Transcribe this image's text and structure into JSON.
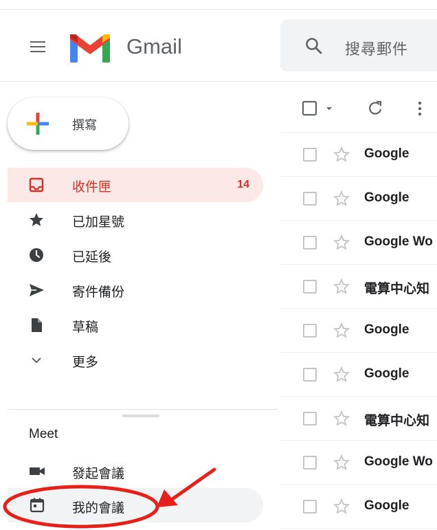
{
  "header": {
    "brand": "Gmail",
    "search_placeholder": "搜尋郵件"
  },
  "compose": {
    "label": "撰寫"
  },
  "nav": {
    "items": [
      {
        "label": "收件匣",
        "count": "14",
        "icon": "inbox-icon",
        "active": true
      },
      {
        "label": "已加星號",
        "icon": "star-icon"
      },
      {
        "label": "已延後",
        "icon": "clock-icon"
      },
      {
        "label": "寄件備份",
        "icon": "send-icon"
      },
      {
        "label": "草稿",
        "icon": "draft-icon"
      },
      {
        "label": "更多",
        "icon": "chevron-down-icon"
      }
    ]
  },
  "meet": {
    "heading": "Meet",
    "items": [
      {
        "label": "發起會議",
        "icon": "video-camera-icon"
      },
      {
        "label": "我的會議",
        "icon": "calendar-icon"
      }
    ]
  },
  "emails": [
    {
      "sender": "Google"
    },
    {
      "sender": "Google"
    },
    {
      "sender": "Google Wo"
    },
    {
      "sender": "電算中心知"
    },
    {
      "sender": "Google"
    },
    {
      "sender": "Google"
    },
    {
      "sender": "電算中心知"
    },
    {
      "sender": "Google Wo"
    },
    {
      "sender": "Google"
    }
  ],
  "colors": {
    "active_bg": "#fce8e6",
    "active_text": "#d93025",
    "annotation": "#e8201a"
  }
}
